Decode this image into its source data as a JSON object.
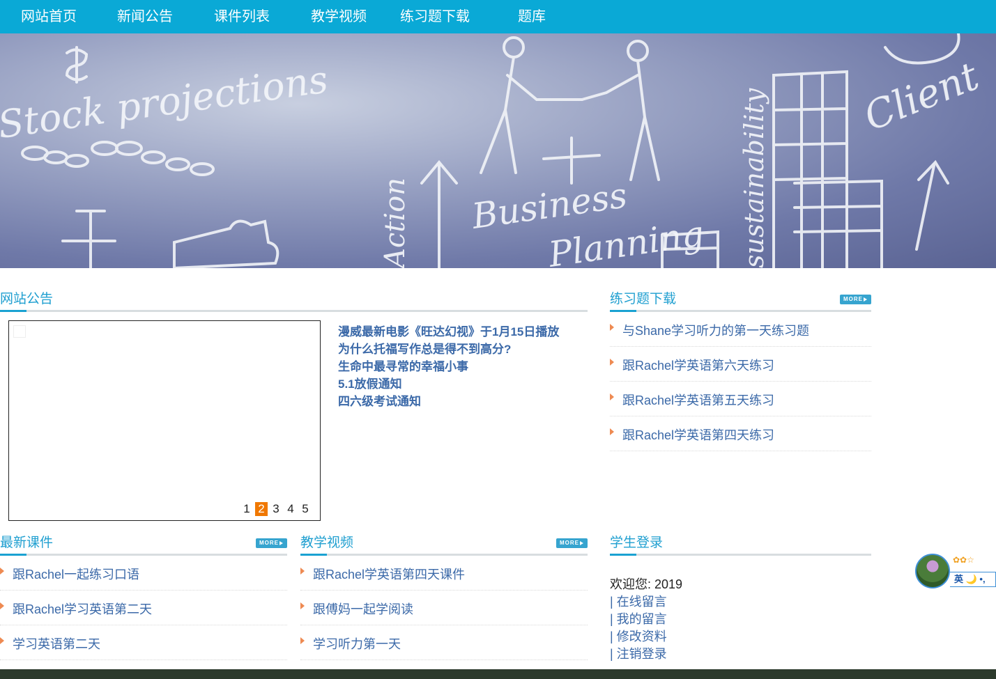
{
  "nav": {
    "items": [
      {
        "label": "网站首页"
      },
      {
        "label": "新闻公告"
      },
      {
        "label": "课件列表"
      },
      {
        "label": "教学视频"
      },
      {
        "label": "练习题下载"
      },
      {
        "label": "题库"
      }
    ]
  },
  "banner": {
    "words": [
      "Stock projections",
      "Business",
      "Planning",
      "Client",
      "sustainability",
      "Action"
    ]
  },
  "announcements": {
    "title": "网站公告",
    "pager": [
      "1",
      "2",
      "3",
      "4",
      "5"
    ],
    "active_page": "2",
    "news": [
      "漫威最新电影《旺达幻视》于1月15日播放",
      "为什么托福写作总是得不到高分?",
      "生命中最寻常的幸福小事",
      "5.1放假通知",
      "四六级考试通知"
    ]
  },
  "exercises": {
    "title": "练习题下载",
    "more": "MORE",
    "items": [
      "与Shane学习听力的第一天练习题",
      "跟Rachel学英语第六天练习",
      "跟Rachel学英语第五天练习",
      "跟Rachel学英语第四天练习"
    ]
  },
  "courses": {
    "title": "最新课件",
    "more": "MORE",
    "items": [
      "跟Rachel一起练习口语",
      "跟Rachel学习英语第二天",
      "学习英语第二天"
    ]
  },
  "videos": {
    "title": "教学视频",
    "more": "MORE",
    "items": [
      "跟Rachel学英语第四天课件",
      "跟傅妈一起学阅读",
      "学习听力第一天"
    ]
  },
  "login": {
    "title": "学生登录",
    "welcome": "欢迎您:   2019",
    "links": [
      "| 在线留言",
      "| 我的留言",
      "| 修改资料",
      "| 注销登录"
    ]
  },
  "float_widget": {
    "label": "英 🌙 •,"
  }
}
